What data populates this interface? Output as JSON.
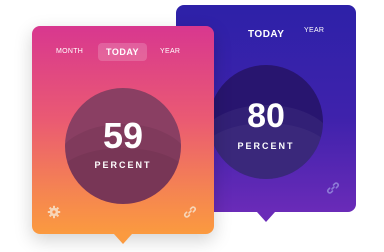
{
  "back_card": {
    "tabs": {
      "today": "TODAY",
      "year": "YEAR"
    },
    "dial": {
      "value": "80",
      "unit": "PERCENT"
    },
    "icons": {
      "link": "link-icon"
    },
    "colors": {
      "top": "#2d21a8",
      "bottom": "#6a2bb8"
    }
  },
  "front_card": {
    "tabs": {
      "month": "MONTH",
      "today": "TODAY",
      "year": "YEAR"
    },
    "dial": {
      "value": "59",
      "unit": "PERCENT"
    },
    "icons": {
      "settings": "gear-icon",
      "link": "link-icon"
    },
    "colors": {
      "top": "#d8378f",
      "bottom": "#fb9a3f"
    }
  }
}
